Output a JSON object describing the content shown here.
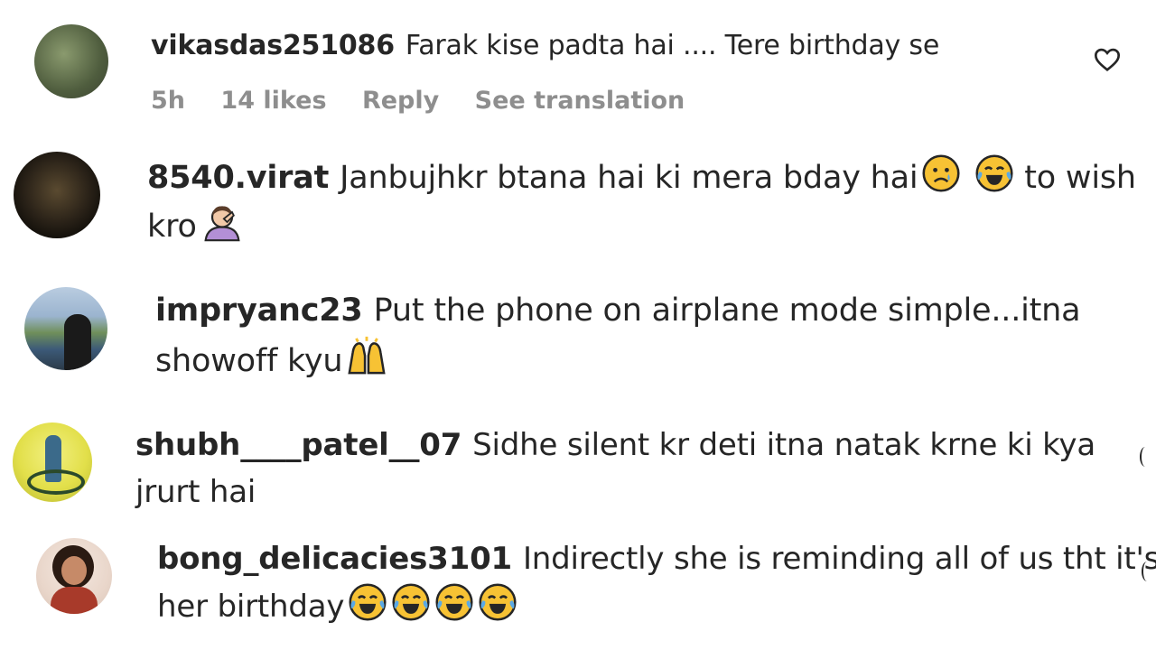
{
  "comments": [
    {
      "username": "vikasdas251086",
      "text": "Farak kise padta hai .... Tere birthday se",
      "meta": {
        "time": "5h",
        "likes": "14 likes",
        "reply": "Reply",
        "translation": "See translation"
      }
    },
    {
      "username": "8540.virat",
      "text_line1": "Janbujhkr btana hai ki mera bday hai",
      "text_line1b": "to wish",
      "text_line2": "kro"
    },
    {
      "username": "impryanc23",
      "text_line1": "Put the phone on airplane mode simple...itna",
      "text_line2": "showoff kyu"
    },
    {
      "username": "shubh____patel__07",
      "text_line1": "Sidhe silent kr deti itna natak krne ki kya",
      "text_line2": "jrurt hai"
    },
    {
      "username": "bong_delicacies3101",
      "text_line1": "Indirectly she is reminding all of us tht it's",
      "text_line2": "her birthday"
    }
  ]
}
